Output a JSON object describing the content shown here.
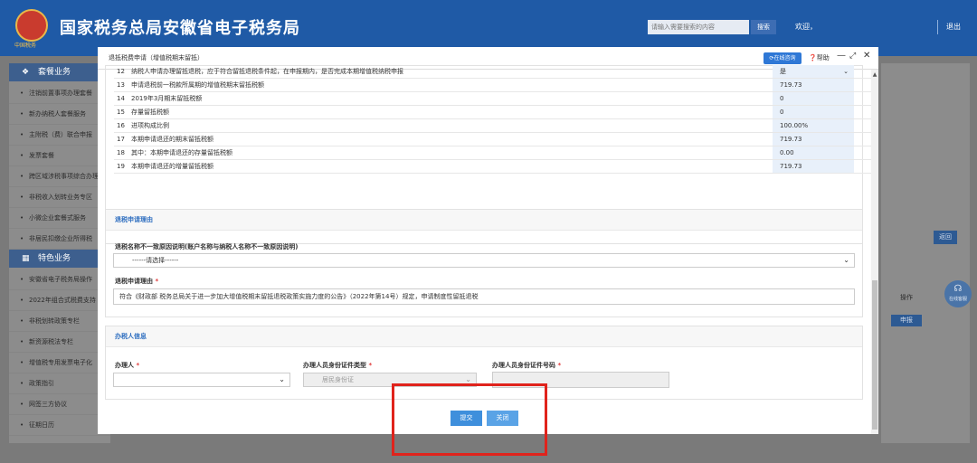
{
  "header": {
    "emblem_caption": "中国税务",
    "title": "国家税务总局安徽省电子税务局",
    "search_placeholder": "请输入需要搜索的内容",
    "search_label": "搜索",
    "welcome": "欢迎，",
    "logout": "退出"
  },
  "sidebar": {
    "section1": "套餐业务",
    "items1": [
      "注销前置事项办理套餐",
      "新办纳税人套餐服务",
      "主附税（费）联合申报",
      "发票套餐",
      "跨区域涉税事项综合办理",
      "非税收入划转业务专区",
      "小微企业套餐式服务",
      "非居民扣缴企业所得税"
    ],
    "section2": "特色业务",
    "items2": [
      "安徽省电子税务局操作",
      "2022年组合式税费支持",
      "非税划转政策专栏",
      "新资源税法专栏",
      "增值税专用发票电子化",
      "政策指引",
      "网签三方协议",
      "征期日历"
    ]
  },
  "background": {
    "return_label": "返回",
    "operation_header": "操作",
    "report_label": "申报",
    "float_service": "在线客服"
  },
  "modal": {
    "title": "退抵税费申请（增值税期末留抵）",
    "online_consult": "在线咨询",
    "help": "帮助",
    "table_rows": [
      {
        "num": "12",
        "label": "纳税人申请办理留抵退税，应于符合留抵退税条件起，在申报期内，是否完成本期增值税纳税申报",
        "value": "是",
        "is_select": true
      },
      {
        "num": "13",
        "label": "申请退税前一税款所属期的增值税期末留抵税额",
        "value": "719.73"
      },
      {
        "num": "14",
        "label": "2019年3月期末留抵税额",
        "value": "0"
      },
      {
        "num": "15",
        "label": "存量留抵税额",
        "value": "0"
      },
      {
        "num": "16",
        "label": "进项构成比例",
        "value": "100.00%"
      },
      {
        "num": "17",
        "label": "本期申请退还的期末留抵税额",
        "value": "719.73"
      },
      {
        "num": "18",
        "label": "其中：本期申请退还的存量留抵税额",
        "value": "0.00"
      },
      {
        "num": "19",
        "label": "本期申请退还的增量留抵税额",
        "value": "719.73"
      }
    ],
    "reason_section": {
      "title": "退税申请理由",
      "mismatch_label": "退税名称不一致原因说明(账户名称与纳税人名称不一致原因说明)",
      "mismatch_select": "------请选择------",
      "reason_label": "退税申请理由",
      "reason_value": "符合《财政部 税务总局关于进一步加大增值税期末留抵退税政策实施力度的公告》（2022年第14号）规定，申请制度性留抵退税"
    },
    "handler_section": {
      "title": "办税人信息",
      "handler_label": "办理人",
      "id_type_label": "办理人员身份证件类型",
      "id_type_value": "居民身份证",
      "id_number_label": "办理人员身份证件号码"
    },
    "submit_label": "提交",
    "close_label": "关闭"
  },
  "colors": {
    "header_blue": "#1f5aa6",
    "accent_blue": "#2f78d6",
    "required_red": "#e03c3c",
    "highlight_box": "#e0231c"
  }
}
